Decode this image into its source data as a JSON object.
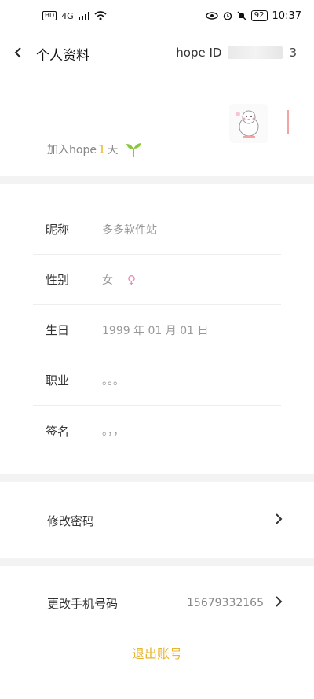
{
  "status_bar": {
    "left_badges": [
      "HD",
      "4G"
    ],
    "battery": "92",
    "time": "10:37"
  },
  "header": {
    "back_icon": "chevron-left-icon",
    "title": "个人资料",
    "hope_id_label": "hope ID",
    "hope_id_value": "3"
  },
  "profile": {
    "join_prefix": "加入hope",
    "join_days": "1",
    "join_suffix": "天"
  },
  "fields": [
    {
      "label": "昵称",
      "value": "多多软件站"
    },
    {
      "label": "性别",
      "value": "女"
    },
    {
      "label": "生日",
      "value": "1999 年 01 月 01 日"
    },
    {
      "label": "职业",
      "value": "。。。"
    },
    {
      "label": "签名",
      "value": "。，，"
    }
  ],
  "actions": {
    "change_password": "修改密码",
    "change_phone": "更改手机号码",
    "phone_number": "15679332165",
    "logout": "退出账号"
  },
  "colors": {
    "accent": "#e8b52e",
    "gender_female": "#e88ab8",
    "separator": "#f3f3f3"
  }
}
